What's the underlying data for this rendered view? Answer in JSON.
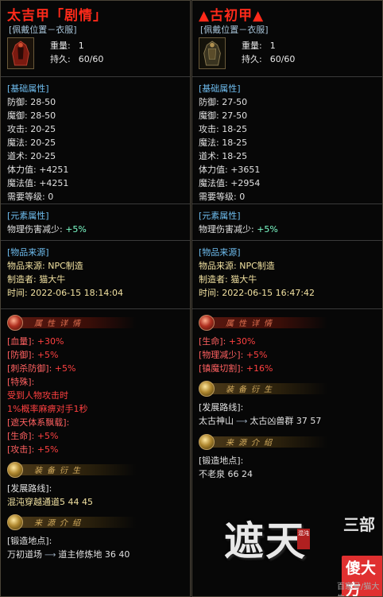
{
  "left": {
    "title": "太吉甲「剧情」",
    "slot": "[佩戴位置－衣服]",
    "weight": {
      "label": "重量:",
      "value": "1"
    },
    "durability": {
      "label": "持久:",
      "value": "60/60"
    },
    "base_header": "[基础属性]",
    "base": [
      {
        "k": "防御:",
        "v": "28-50"
      },
      {
        "k": "魔御:",
        "v": "28-50"
      },
      {
        "k": "攻击:",
        "v": "20-25"
      },
      {
        "k": "魔法:",
        "v": "20-25"
      },
      {
        "k": "道术:",
        "v": "20-25"
      },
      {
        "k": "体力值:",
        "v": "+4251"
      },
      {
        "k": "魔法值:",
        "v": "+4251"
      },
      {
        "k": "需要等级:",
        "v": "0"
      }
    ],
    "element_header": "[元素属性]",
    "element": {
      "k": "物理伤害减少:",
      "v": "+5%"
    },
    "source_header": "[物品来源]",
    "source": [
      {
        "k": "物品来源:",
        "v": "NPC制造"
      },
      {
        "k": "制造者:",
        "v": "猫大牛"
      },
      {
        "k": "时间:",
        "v": "2022-06-15 18:14:04"
      }
    ],
    "banner1": "属性详情",
    "attrs": [
      {
        "k": "[血量]:",
        "v": "+30%"
      },
      {
        "k": "[防御]:",
        "v": "+5%"
      },
      {
        "k": "[刺杀防御]:",
        "v": "+5%"
      }
    ],
    "special_header": "[特殊]:",
    "special_lines": [
      "受到人物攻击时",
      "1%概率麻痹对手1秒"
    ],
    "set_header": "[遮天体系飘载]:",
    "set_attrs": [
      {
        "k": "[生命]:",
        "v": "+5%"
      },
      {
        "k": "[攻击]:",
        "v": "+5%"
      }
    ],
    "banner2": "装备衍生",
    "dev_label": "[发展路线]:",
    "dev_path": {
      "from": "混沌穿越通道5",
      "to": "44 45"
    },
    "banner3": "来源介绍",
    "forge_label": "[锻造地点]:",
    "forge_path": {
      "from": "万初道场",
      "to": "道主修炼地",
      "coords": "36 40"
    }
  },
  "right": {
    "title": "▲古初甲▲",
    "slot": "[佩戴位置－衣服]",
    "weight": {
      "label": "重量:",
      "value": "1"
    },
    "durability": {
      "label": "持久:",
      "value": "60/60"
    },
    "base_header": "[基础属性]",
    "base": [
      {
        "k": "防御:",
        "v": "27-50"
      },
      {
        "k": "魔御:",
        "v": "27-50"
      },
      {
        "k": "攻击:",
        "v": "18-25"
      },
      {
        "k": "魔法:",
        "v": "18-25"
      },
      {
        "k": "道术:",
        "v": "18-25"
      },
      {
        "k": "体力值:",
        "v": "+3651"
      },
      {
        "k": "魔法值:",
        "v": "+2954"
      },
      {
        "k": "需要等级:",
        "v": "0"
      }
    ],
    "element_header": "[元素属性]",
    "element": {
      "k": "物理伤害减少:",
      "v": "+5%"
    },
    "source_header": "[物品来源]",
    "source": [
      {
        "k": "物品来源:",
        "v": "NPC制造"
      },
      {
        "k": "制造者:",
        "v": "猫大牛"
      },
      {
        "k": "时间:",
        "v": "2022-06-15 16:47:42"
      }
    ],
    "banner1": "属性详情",
    "attrs": [
      {
        "k": "[生命]:",
        "v": "+30%"
      },
      {
        "k": "[物理减少]:",
        "v": "+5%"
      },
      {
        "k": "[镇魔切割]:",
        "v": "+16%"
      }
    ],
    "banner2": "装备衍生",
    "dev_label": "[发展路线]:",
    "dev_path": {
      "from": "太古神山",
      "to": "太古凶兽群",
      "coords": "37 57"
    },
    "banner3": "来源介绍",
    "forge_label": "[锻造地点]:",
    "forge_value": "不老泉 66 24"
  },
  "logo": {
    "big": "遮天",
    "side": "三部",
    "stamp": "混沌"
  },
  "watermark": {
    "badge": "傻大方",
    "credit": "百家号/猫大牛"
  },
  "colors": {
    "title": "#ff2a1a",
    "header": "#6fbef0",
    "green": "#7dffcb",
    "red": "#ff4040",
    "border": "#4a4438"
  },
  "icons": [
    "armor-icon",
    "arrow-right-icon"
  ]
}
